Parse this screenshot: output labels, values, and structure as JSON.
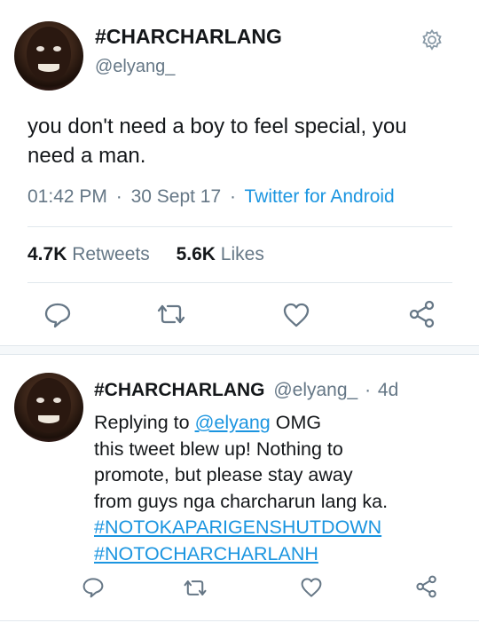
{
  "main_tweet": {
    "display_name": "#CHARCHARLANG",
    "handle": "@elyang_",
    "text_lines": [
      "you don't need a boy to feel special, you",
      "need a man."
    ],
    "time": "01:42 PM",
    "dot1": "·",
    "date": "30 Sept 17",
    "dot2": "·",
    "source": "Twitter for Android",
    "retweets_count": "4.7K",
    "retweets_label": "Retweets",
    "likes_count": "5.6K",
    "likes_label": "Likes"
  },
  "reply_tweet": {
    "display_name": "#CHARCHARLANG",
    "handle": "@elyang_",
    "dot": "·",
    "age": "4d",
    "replying_prefix": "Replying to",
    "replying_to": "@elyang",
    "line1_rest": "OMG",
    "line2": "this tweet blew up! Nothing to",
    "line3": "promote, but please stay away",
    "line4": "from guys nga charcharun lang ka.",
    "hashtag1": "#NOTOKAPARIGENSHUTDOWN",
    "hashtag2": "#NOTOCHARCHARLANH"
  },
  "colors": {
    "accent": "#1b95e0",
    "muted": "#657786",
    "icon": "#667786"
  }
}
